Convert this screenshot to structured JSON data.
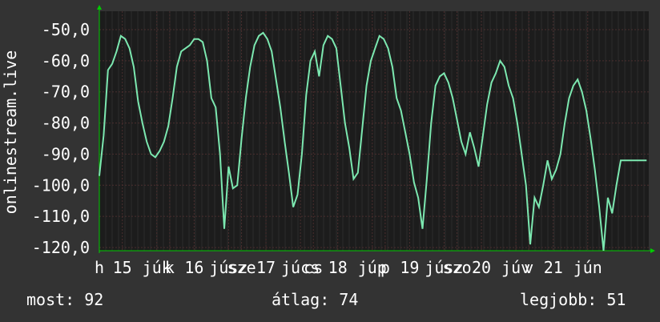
{
  "chart_data": {
    "type": "line",
    "ylabel": "onlinestream.live",
    "ylim": [
      -120,
      -45
    ],
    "yticks": [
      "-50,0",
      "-60,0",
      "-70,0",
      "-80,0",
      "-90,0",
      "-100,0",
      "-110,0",
      "-120,0"
    ],
    "ytick_values": [
      -50,
      -60,
      -70,
      -80,
      -90,
      -100,
      -110,
      -120
    ],
    "xlim": [
      0,
      7.65
    ],
    "xticks": [
      {
        "label": "h",
        "pos": 0.0
      },
      {
        "label": "15",
        "pos": 0.32
      },
      {
        "label": "júk",
        "pos": 0.8
      },
      {
        "label": "k",
        "pos": 0.98
      },
      {
        "label": "16",
        "pos": 1.32
      },
      {
        "label": "júsz",
        "pos": 1.8
      },
      {
        "label": "sze",
        "pos": 1.98
      },
      {
        "label": "17",
        "pos": 2.32
      },
      {
        "label": "júcs",
        "pos": 2.8
      },
      {
        "label": "cs",
        "pos": 2.98
      },
      {
        "label": "18",
        "pos": 3.32
      },
      {
        "label": "júp",
        "pos": 3.8
      },
      {
        "label": "p",
        "pos": 3.98
      },
      {
        "label": "19",
        "pos": 4.32
      },
      {
        "label": "júsz",
        "pos": 4.8
      },
      {
        "label": "szo",
        "pos": 4.98
      },
      {
        "label": "20",
        "pos": 5.32
      },
      {
        "label": "júv",
        "pos": 5.8
      },
      {
        "label": "v",
        "pos": 5.98
      },
      {
        "label": "21",
        "pos": 6.32
      },
      {
        "label": "jún",
        "pos": 6.8
      }
    ],
    "grid": true,
    "colors": {
      "line": "#7ce8b0",
      "background": "#1c1c1c",
      "grid": "#3a3a3a",
      "axis": "#00cc00"
    },
    "series": [
      {
        "x": [
          0.0,
          0.06,
          0.12,
          0.18,
          0.24,
          0.3,
          0.36,
          0.42,
          0.48,
          0.54,
          0.6,
          0.66,
          0.72,
          0.78,
          0.84,
          0.9,
          0.96,
          1.02,
          1.08,
          1.14,
          1.2,
          1.26,
          1.32,
          1.38,
          1.44,
          1.5,
          1.56,
          1.62,
          1.68,
          1.74,
          1.8,
          1.86,
          1.92,
          1.98,
          2.04,
          2.1,
          2.16,
          2.22,
          2.28,
          2.34,
          2.4,
          2.46,
          2.52,
          2.58,
          2.64,
          2.7,
          2.76,
          2.82,
          2.88,
          2.94,
          3.0,
          3.06,
          3.12,
          3.18,
          3.24,
          3.3,
          3.36,
          3.42,
          3.48,
          3.54,
          3.6,
          3.66,
          3.72,
          3.78,
          3.84,
          3.9,
          3.96,
          4.02,
          4.08,
          4.14,
          4.2,
          4.26,
          4.32,
          4.38,
          4.44,
          4.5,
          4.56,
          4.62,
          4.68,
          4.74,
          4.8,
          4.86,
          4.92,
          4.98,
          5.04,
          5.1,
          5.16,
          5.22,
          5.28,
          5.34,
          5.4,
          5.46,
          5.52,
          5.58,
          5.64,
          5.7,
          5.76,
          5.82,
          5.88,
          5.94,
          6.0,
          6.06,
          6.12,
          6.18,
          6.24,
          6.3,
          6.36,
          6.42,
          6.48,
          6.54,
          6.6,
          6.66,
          6.72,
          6.78,
          6.84,
          6.9,
          6.96,
          7.02,
          7.08,
          7.14,
          7.2,
          7.26,
          7.32,
          7.38,
          7.44,
          7.5,
          7.56,
          7.62
        ],
        "y": [
          -97,
          -84,
          -63,
          -61,
          -57,
          -52,
          -53,
          -56,
          -62,
          -73,
          -80,
          -86,
          -90,
          -91,
          -89,
          -86,
          -81,
          -72,
          -62,
          -57,
          -56,
          -55,
          -53,
          -53,
          -54,
          -60,
          -72,
          -75,
          -90,
          -114,
          -94,
          -101,
          -100,
          -85,
          -72,
          -62,
          -55,
          -52,
          -51,
          -53,
          -57,
          -66,
          -75,
          -86,
          -96,
          -107,
          -103,
          -90,
          -71,
          -60,
          -57,
          -65,
          -55,
          -52,
          -53,
          -56,
          -68,
          -80,
          -88,
          -98,
          -96,
          -82,
          -68,
          -60,
          -56,
          -52,
          -53,
          -56,
          -62,
          -72,
          -76,
          -83,
          -90,
          -99,
          -104,
          -114,
          -98,
          -80,
          -68,
          -65,
          -64,
          -67,
          -72,
          -79,
          -86,
          -90,
          -83,
          -88,
          -94,
          -84,
          -74,
          -67,
          -64,
          -60,
          -62,
          -68,
          -72,
          -80,
          -90,
          -100,
          -119,
          -104,
          -107,
          -100,
          -92,
          -98,
          -95,
          -90,
          -80,
          -72,
          -68,
          -66,
          -70,
          -76,
          -85,
          -95,
          -107,
          -121,
          -104,
          -109,
          -100,
          -92,
          -92,
          -92,
          -92,
          -92,
          -92,
          -92
        ]
      }
    ]
  },
  "stats": {
    "current": "most: 92",
    "average": "átlag: 74",
    "best": "legjobb: 51"
  }
}
